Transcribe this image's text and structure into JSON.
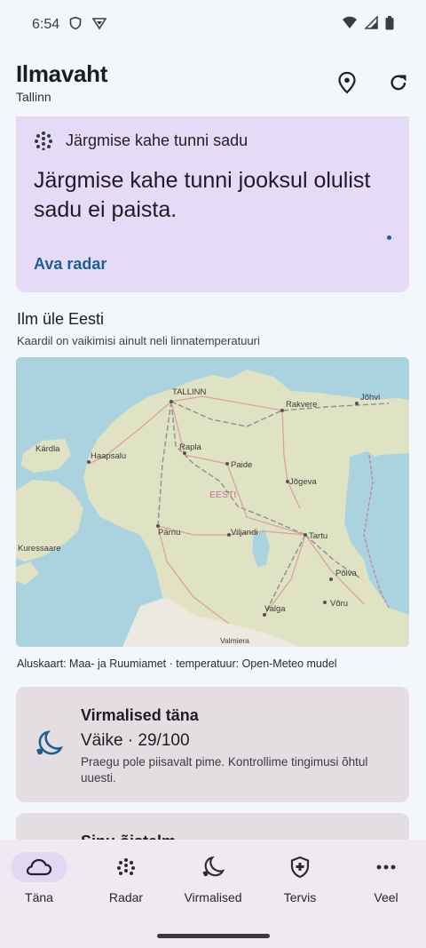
{
  "status_bar": {
    "time": "6:54"
  },
  "header": {
    "title": "Ilmavaht",
    "subtitle": "Tallinn"
  },
  "rain_card": {
    "heading": "Järgmise kahe tunni sadu",
    "message": "Järgmise kahe tunni jooksul olulist sadu ei paista.",
    "link": "Ava radar"
  },
  "map_section": {
    "title": "Ilm üle Eesti",
    "subtitle": "Kaardil on vaikimisi ainult neli linnatemperatuuri",
    "caption": "Aluskaart: Maa- ja Ruumiamet · temperatuur: Open-Meteo mudel",
    "labels": {
      "tallinn": "TALLINN",
      "rakvere": "Rakvere",
      "johvi": "Jõhvi",
      "kardla": "Kärdla",
      "haapsalu": "Haapsalu",
      "rapla": "Rapla",
      "paide": "Paide",
      "eesti": "EESTI",
      "jogeva": "Jõgeva",
      "parnu": "Pärnu",
      "viljandi": "Viljandi",
      "tartu": "Tartu",
      "kuressaare": "Kuressaare",
      "polva": "Põlva",
      "valga": "Valga",
      "voru": "Võru",
      "valmiera": "Valmiera"
    }
  },
  "aurora_card": {
    "title": "Virmalised täna",
    "level": "Väike · 29/100",
    "description": "Praegu pole piisavalt pime. Kontrollime tingimusi õhtul uuesti."
  },
  "next_card": {
    "title": "Sinu õistelm"
  },
  "bottom_nav": {
    "items": [
      {
        "label": "Täna",
        "icon": "cloud-icon"
      },
      {
        "label": "Radar",
        "icon": "radar-dots-icon"
      },
      {
        "label": "Virmalised",
        "icon": "moon-icon"
      },
      {
        "label": "Tervis",
        "icon": "health-shield-icon"
      },
      {
        "label": "Veel",
        "icon": "more-dots-icon"
      }
    ]
  },
  "colors": {
    "accent_link": "#1f5f8e",
    "rain_card_bg": "#e6dbf6",
    "nav_active": "#e2d8f4",
    "card_bg": "#e4dee3"
  }
}
